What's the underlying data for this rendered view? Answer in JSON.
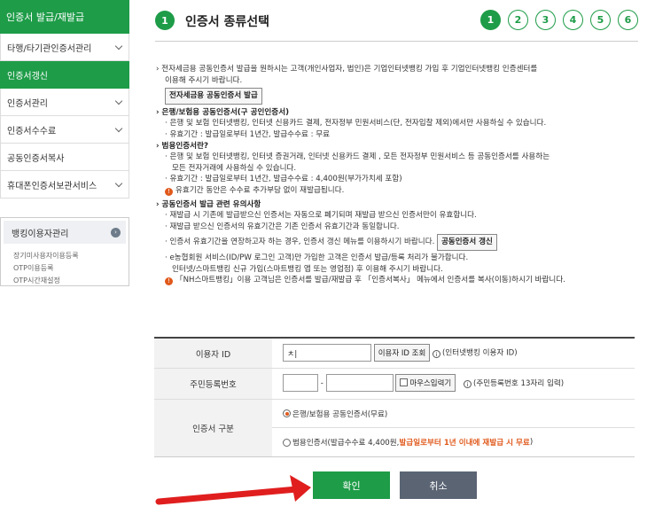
{
  "sidebar": {
    "header": "인증서 발급/재발급",
    "items": [
      {
        "label": "타행/타기관인증서관리",
        "chevron": true,
        "active": false
      },
      {
        "label": "인증서갱신",
        "chevron": false,
        "active": true
      },
      {
        "label": "인증서관리",
        "chevron": true,
        "active": false
      },
      {
        "label": "인증서수수료",
        "chevron": true,
        "active": false
      },
      {
        "label": "공동인증서복사",
        "chevron": false,
        "active": false
      },
      {
        "label": "휴대폰인증서보관서비스",
        "chevron": true,
        "active": false
      }
    ],
    "banking": {
      "title": "뱅킹이용자관리",
      "subs": [
        "장기미사용자이용등록",
        "OTP이용등록",
        "OTP시간재설정"
      ]
    }
  },
  "header": {
    "step_number": "1",
    "title": "인증서 종류선택",
    "steps": [
      "1",
      "2",
      "3",
      "4",
      "5",
      "6"
    ]
  },
  "info": {
    "intro_line1": "전자세금용 공동인증서 발급을 원하시는 고객(개인사업자, 법인)은 기업인터넷뱅킹 가입 후 기업인터넷뱅킹 인증센터를",
    "intro_line2": "이용해 주시기 바랍니다.",
    "tax_cert_button": "전자세금용 공동인증서 발급",
    "bank_title": "은행/보험용 공동인증서(구 공인인증서)",
    "bank_desc": "· 은행 및 보험 인터넷뱅킹, 인터넷 신용카드 결제, 전자정부 민원서비스(단, 전자입찰 제외)에서만 사용하실 수 있습니다.",
    "bank_validity": "· 유효기간 : 발급일로부터 1년간, 발급수수료 : 무료",
    "general_title": "범용인증서란?",
    "general_desc1": "· 은행 및 보험 인터넷뱅킹, 인터넷 증권거래, 인터넷 신용카드 결제 , 모든 전자정부 민원서비스 등 공동인증서를 사용하는",
    "general_desc2": "모든 전자거래에 사용하실 수 있습니다.",
    "general_validity": "· 유효기간 : 발급일로부터 1년간, 발급수수료 : 4,400원(부가가치세 포함)",
    "general_warning": "유효기간 동안은 수수료 추가부담 없이 재발급됩니다.",
    "notice_title": "공동인증서 발급 관련 유의사항",
    "notice1": "· 재발급 시 기존에 발급받으신 인증서는 자동으로 폐기되며 재발급 받으신 인증서만이 유효합니다.",
    "notice2": "· 재발급 받으신 인증서의 유효기간은 기존 인증서 유효기간과 동일합니다.",
    "notice3": "· 인증서 유효기간을 연장하고자 하는 경우, 인증서 갱신 메뉴를 이용하시기 바랍니다.",
    "renew_button": "공동인증서 갱신",
    "notice4a": "· e농협회원 서비스(ID/PW 로그인 고객)만 가입한 고객은 인증서 발급/등록 처리가 불가합니다.",
    "notice4b": "인터넷/스마트뱅킹 신규 가입(스마트뱅킹 앱 또는 영업점) 후 이용해 주시기 바랍니다.",
    "nh_warning": "「NH스마트뱅킹」이용 고객님은 인증서를 발급/재발급 후 「인증서복사」 메뉴에서 인증서를 복사(이동)하시기 바랍니다."
  },
  "form": {
    "user_id_label": "이용자 ID",
    "user_id_value": "ㅊ|",
    "user_id_lookup": "이용자 ID 조회",
    "user_id_hint": "(인터넷뱅킹 이용자 ID)",
    "rrn_label": "주민등록번호",
    "rrn_dash": "-",
    "mouse_input": "마우스입력기",
    "rrn_hint": "(주민등록번호 13자리 입력)",
    "cert_type_label": "인증서 구분",
    "option1": "은행/보험용 공동인증서(무료)",
    "option2_prefix": "범용인증서(발급수수료 4,400원, ",
    "option2_highlight": "발급일로부터 1년 이내에 재발급 시 무료",
    "option2_suffix": ")"
  },
  "buttons": {
    "confirm": "확인",
    "cancel": "취소"
  },
  "colors": {
    "brand_green": "#1e9c48",
    "warning_orange": "#e0591b",
    "cancel_grey": "#5a6473",
    "arrow_red": "#e01e1e"
  }
}
